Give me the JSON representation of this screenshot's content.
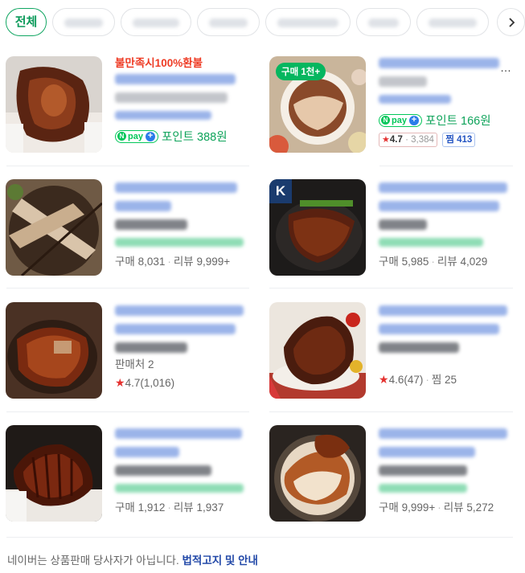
{
  "filters": {
    "active_label": "전체",
    "chip_count": 7
  },
  "products": [
    {
      "id": "p1",
      "promo": "불만족시100%환불",
      "pay_label": "pay",
      "point_text": "포인트 388원"
    },
    {
      "id": "p2",
      "thumb_badge": "구매 1천+",
      "pay_label": "pay",
      "point_text": "포인트 166원",
      "rating": "4.7",
      "rating_count": "3,384",
      "zzim_label": "찜",
      "zzim_count": "413"
    },
    {
      "id": "p3",
      "meta": {
        "purchase": "구매 8,031",
        "review": "리뷰 9,999+"
      }
    },
    {
      "id": "p4",
      "thumb_badge": "K",
      "meta": {
        "purchase": "구매 5,985",
        "review": "리뷰 4,029"
      }
    },
    {
      "id": "p5",
      "seller": "판매처 2",
      "rating": "4.7",
      "rating_count": "(1,016)"
    },
    {
      "id": "p6",
      "rating": "4.6",
      "rating_count": "(47)",
      "zzim": "찜 25"
    },
    {
      "id": "p7",
      "meta": {
        "purchase": "구매 1,912",
        "review": "리뷰 1,937"
      }
    },
    {
      "id": "p8",
      "meta": {
        "purchase": "구매 9,999+",
        "review": "리뷰 5,272"
      }
    }
  ],
  "footer": {
    "disclaimer": "네이버는 상품판매 당사자가 아닙니다.",
    "link": "법적고지 및 안내"
  },
  "colors": {
    "accent_green": "#03c75a",
    "star_red": "#e4312f",
    "promo_red": "#ee3b24",
    "link_blue": "#2349a8"
  }
}
